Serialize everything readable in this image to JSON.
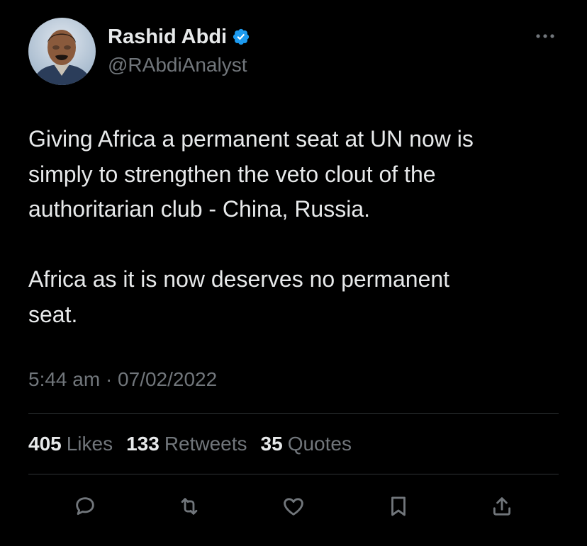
{
  "author": {
    "display_name": "Rashid Abdi",
    "handle": "@RAbdiAnalyst",
    "verified": true,
    "verified_color": "#1d9bf0"
  },
  "tweet": {
    "text": "Giving Africa a permanent seat at UN now is\nsimply to strengthen the veto clout of the\nauthoritarian club - China, Russia.\n\nAfrica as it is now deserves no permanent\nseat.",
    "timestamp": "5:44 am · 07/02/2022"
  },
  "stats": {
    "likes_count": "405",
    "likes_label": "Likes",
    "retweets_count": "133",
    "retweets_label": "Retweets",
    "quotes_count": "35",
    "quotes_label": "Quotes"
  },
  "actions": [
    "reply-icon",
    "retweet-icon",
    "like-icon",
    "bookmark-icon",
    "share-icon"
  ],
  "colors": {
    "background": "#000000",
    "primary_text": "#e7e9ea",
    "secondary_text": "#71767b",
    "divider": "#2f3336"
  }
}
